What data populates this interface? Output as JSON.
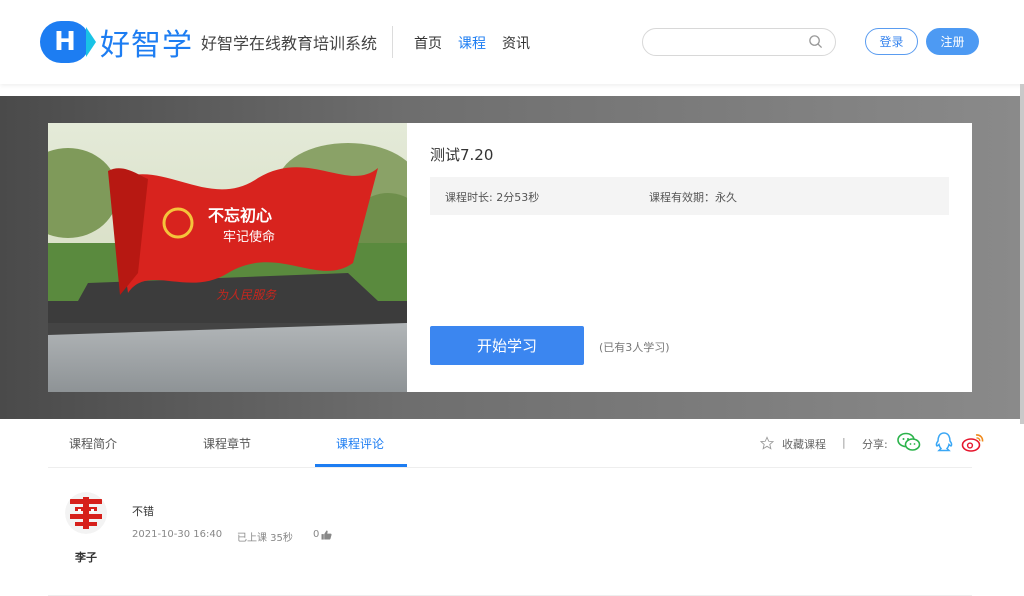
{
  "header": {
    "logo_letter": "H",
    "logo_name": "好智学",
    "logo_subtitle": "好智学在线教育培训系统",
    "nav": [
      {
        "label": "首页",
        "active": false
      },
      {
        "label": "课程",
        "active": true
      },
      {
        "label": "资讯",
        "active": false
      }
    ],
    "search_placeholder": "",
    "login_label": "登录",
    "register_label": "注册"
  },
  "course": {
    "title": "测试7.20",
    "duration": "课程时长: 2分53秒",
    "validity": "课程有效期：永久",
    "start_label": "开始学习",
    "learners": "(已有3人学习)",
    "image_text_main": "不忘初心",
    "image_text_sub": "牢记使命",
    "image_text_base": "为人民服务"
  },
  "tabs": [
    {
      "label": "课程简介",
      "active": false
    },
    {
      "label": "课程章节",
      "active": false
    },
    {
      "label": "课程评论",
      "active": true
    }
  ],
  "actions": {
    "favorite_label": "收藏课程",
    "separator": "|",
    "share_label": "分享:"
  },
  "comments": [
    {
      "username": "李子",
      "text": "不错",
      "date": "2021-10-30 16:40",
      "progress": "已上课 35秒",
      "likes": "0"
    }
  ],
  "colors": {
    "brand": "#1d7df2",
    "wechat": "#2bb34b",
    "qq": "#3aa7f5",
    "weibo": "#e6162d"
  }
}
